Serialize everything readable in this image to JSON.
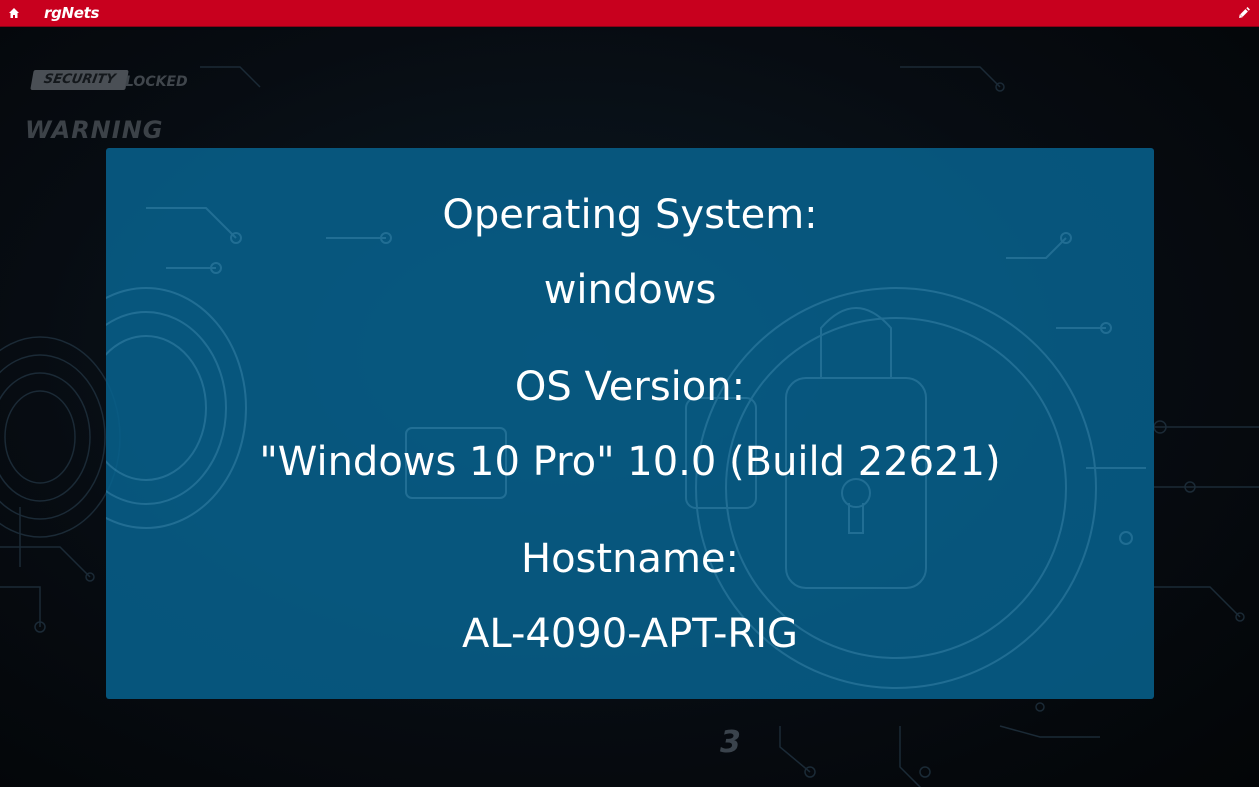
{
  "topbar": {
    "logo_text": "rgNets",
    "home_icon": "home-icon",
    "edit_icon": "pencil-icon",
    "color": "#c8001e"
  },
  "background": {
    "stamp_security": "SECURITY",
    "stamp_locked": "LOCKED",
    "stamp_warning": "WARNING"
  },
  "panel": {
    "color": "#07628e",
    "os_label": "Operating System:",
    "os_value": "windows",
    "version_label": "OS Version:",
    "version_value": "\"Windows 10 Pro\" 10.0 (Build 22621)",
    "hostname_label": "Hostname:",
    "hostname_value": "AL-4090-APT-RIG"
  }
}
